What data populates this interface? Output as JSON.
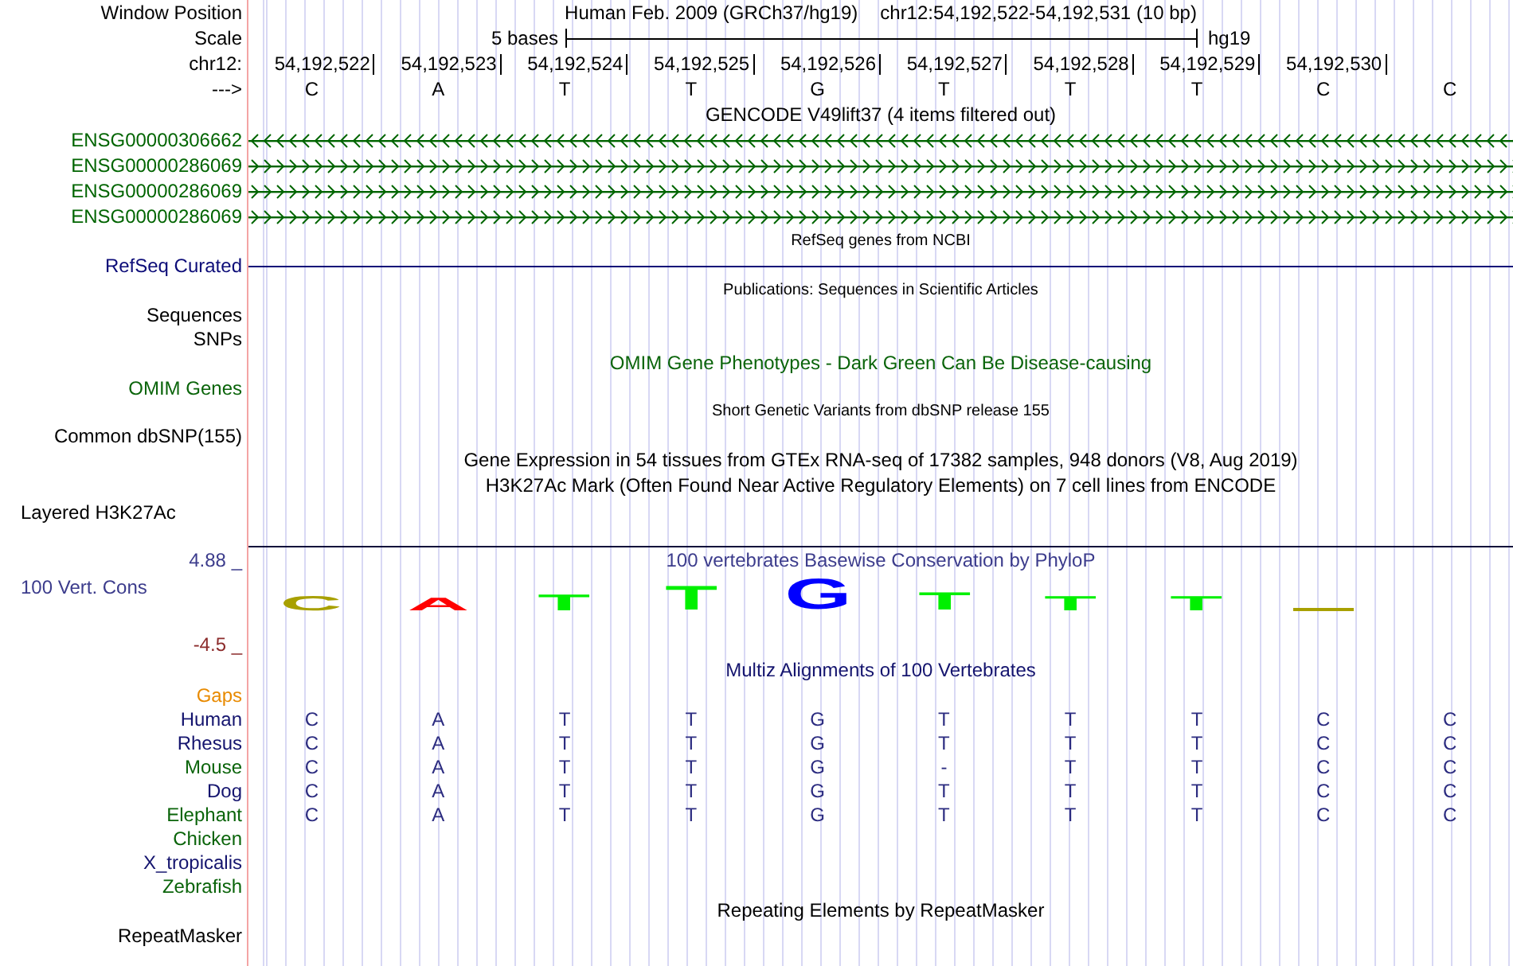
{
  "tracks": [
    {
      "kind": "title",
      "label": "Window Position",
      "texts": [
        "Human Feb. 2009 (GRCh37/hg19)",
        "chr12:54,192,522-54,192,531 (10 bp)"
      ]
    },
    {
      "kind": "scale",
      "label": "Scale",
      "span": "5 bases",
      "assembly": "hg19"
    },
    {
      "kind": "ruler",
      "label": "chr12:",
      "positions": [
        "54,192,522",
        "54,192,523",
        "54,192,524",
        "54,192,525",
        "54,192,526",
        "54,192,527",
        "54,192,528",
        "54,192,529",
        "54,192,530"
      ]
    },
    {
      "kind": "bases",
      "label": "--->",
      "bases": [
        "C",
        "A",
        "T",
        "T",
        "G",
        "T",
        "T",
        "T",
        "C",
        "C"
      ]
    },
    {
      "kind": "heading",
      "title": "GENCODE V49lift37 (4 items filtered out)",
      "color": "#000000"
    },
    {
      "kind": "reversegene",
      "label": "ENSG00000306662",
      "color": "#006400"
    },
    {
      "kind": "gene",
      "label": "ENSG00000286069",
      "color": "#006400"
    },
    {
      "kind": "gene",
      "label": "ENSG00000286069",
      "color": "#006400"
    },
    {
      "kind": "gene",
      "label": "ENSG00000286069",
      "color": "#006400"
    },
    {
      "kind": "caption",
      "title": "RefSeq genes from NCBI"
    },
    {
      "kind": "line",
      "label": "RefSeq Curated",
      "color": "#0c0c78"
    },
    {
      "kind": "caption",
      "title": "Publications: Sequences in Scientific Articles"
    },
    {
      "kind": "label",
      "label": "Sequences",
      "color": "#000000"
    },
    {
      "kind": "label",
      "label": "SNPs",
      "color": "#000000"
    },
    {
      "kind": "heading",
      "title": "OMIM Gene Phenotypes - Dark Green Can Be Disease-causing",
      "color": "#0a640a"
    },
    {
      "kind": "label",
      "label": "OMIM Genes",
      "color": "#0a640a"
    },
    {
      "kind": "caption",
      "title": "Short Genetic Variants from dbSNP release 155"
    },
    {
      "kind": "label",
      "label": "Common dbSNP(155)",
      "color": "#000000"
    },
    {
      "kind": "heading",
      "title": "Gene Expression in 54 tissues from GTEx RNA-seq of 17382 samples, 948 donors (V8, Aug 2019)",
      "color": "#000000"
    },
    {
      "kind": "heading",
      "title": "H3K27Ac Mark (Often Found Near Active Regulatory Elements) on 7 cell lines from ENCODE",
      "color": "#000000"
    },
    {
      "kind": "grouplabel",
      "label": "Layered H3K27Ac"
    },
    {
      "kind": "rule"
    },
    {
      "kind": "axis",
      "label": "4.88 _",
      "title": "100 vertebrates Basewise Conservation by PhyloP",
      "color": "#3c3c8c"
    },
    {
      "kind": "logo",
      "label": "100 Vert. Cons",
      "color": "#3c3c8c",
      "letters": [
        {
          "kind": "letter",
          "base": "C",
          "color": "#a8a000"
        },
        {
          "kind": "letter",
          "base": "A",
          "color": "#ff0000"
        },
        {
          "kind": "letter",
          "base": "T",
          "color": "#00f000"
        },
        {
          "kind": "letter",
          "base": "T",
          "color": "#00f000"
        },
        {
          "kind": "letter",
          "base": "G",
          "color": "#0000ff"
        },
        {
          "kind": "letter",
          "base": "T",
          "color": "#00f000"
        },
        {
          "kind": "letter",
          "base": "T",
          "color": "#00f000"
        },
        {
          "kind": "letter",
          "base": "T",
          "color": "#00f000"
        },
        {
          "kind": "flat",
          "color": "#a8a000"
        }
      ]
    },
    {
      "kind": "axis",
      "label": "-4.5 _",
      "color": "#8c2c2c"
    },
    {
      "kind": "heading",
      "title": "Multiz Alignments of 100 Vertebrates",
      "color": "#14146e"
    },
    {
      "kind": "label",
      "label": "Gaps",
      "color": "#e88a00"
    },
    {
      "kind": "alignment",
      "label": "Human",
      "color": "#14146e",
      "bases": [
        "C",
        "A",
        "T",
        "T",
        "G",
        "T",
        "T",
        "T",
        "C",
        "C"
      ]
    },
    {
      "kind": "alignment",
      "label": "Rhesus",
      "color": "#14146e",
      "bases": [
        "C",
        "A",
        "T",
        "T",
        "G",
        "T",
        "T",
        "T",
        "C",
        "C"
      ]
    },
    {
      "kind": "alignment",
      "label": "Mouse",
      "color": "#0a640a",
      "bases": [
        "C",
        "A",
        "T",
        "T",
        "G",
        "-",
        "T",
        "T",
        "C",
        "C"
      ]
    },
    {
      "kind": "alignment",
      "label": "Dog",
      "color": "#14146e",
      "bases": [
        "C",
        "A",
        "T",
        "T",
        "G",
        "T",
        "T",
        "T",
        "C",
        "C"
      ]
    },
    {
      "kind": "alignment",
      "label": "Elephant",
      "color": "#0a640a",
      "bases": [
        "C",
        "A",
        "T",
        "T",
        "G",
        "T",
        "T",
        "T",
        "C",
        "C"
      ]
    },
    {
      "kind": "alignment",
      "label": "Chicken",
      "color": "#0a640a"
    },
    {
      "kind": "alignment",
      "label": "X_tropicalis",
      "color": "#14146e"
    },
    {
      "kind": "alignment",
      "label": "Zebrafish",
      "color": "#0a640a"
    },
    {
      "kind": "heading",
      "title": "Repeating Elements by RepeatMasker",
      "color": "#000000"
    },
    {
      "kind": "label",
      "label": "RepeatMasker",
      "color": "#000000"
    }
  ]
}
